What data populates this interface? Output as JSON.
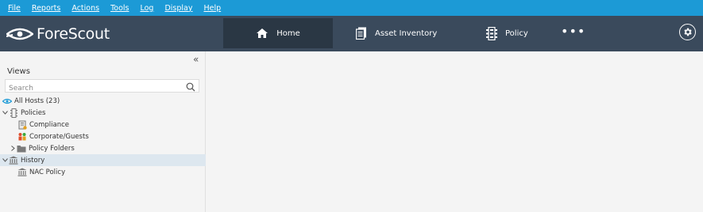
{
  "menubar": {
    "items": [
      {
        "label": "File"
      },
      {
        "label": "Reports"
      },
      {
        "label": "Actions"
      },
      {
        "label": "Tools"
      },
      {
        "label": "Log"
      },
      {
        "label": "Display"
      },
      {
        "label": "Help"
      }
    ]
  },
  "header": {
    "logo_text": "ForeScout",
    "tabs": [
      {
        "label": "Home",
        "icon": "home-icon",
        "active": true
      },
      {
        "label": "Asset Inventory",
        "icon": "asset-inventory-icon"
      },
      {
        "label": "Policy",
        "icon": "policy-icon"
      }
    ],
    "more_label": "•••",
    "colors": {
      "menubar": "#1c9ad6",
      "header": "#3a4a5c",
      "active_tab": "#2a3744"
    }
  },
  "left_panel": {
    "collapse_label": "«",
    "views_title": "Views",
    "search": {
      "placeholder": "Search",
      "value": ""
    },
    "tree": [
      {
        "label": "All Hosts (23)",
        "icon": "all-hosts-icon"
      },
      {
        "label": "Policies",
        "icon": "policies-icon",
        "expanded": true
      },
      {
        "label": "Compliance",
        "icon": "compliance-icon"
      },
      {
        "label": "Corporate/Guests",
        "icon": "corporate-guests-icon"
      },
      {
        "label": "Policy Folders",
        "icon": "folder-icon",
        "expanded": false
      },
      {
        "label": "History",
        "icon": "history-icon",
        "expanded": true,
        "selected": true
      },
      {
        "label": "NAC Policy",
        "icon": "nac-policy-icon"
      }
    ]
  }
}
